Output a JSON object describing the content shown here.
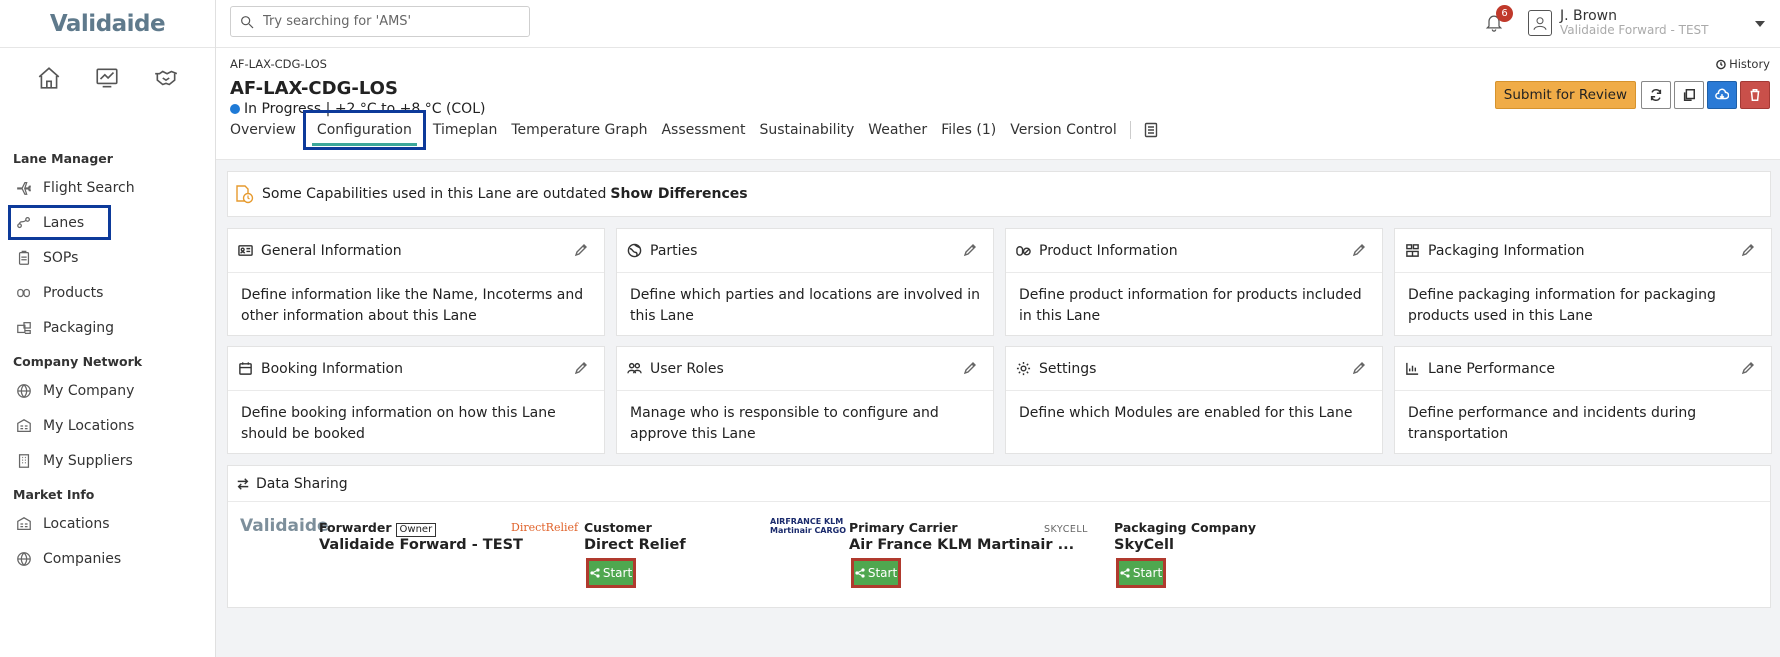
{
  "app": {
    "logo_text": "Validaide"
  },
  "search": {
    "placeholder": "Try searching for 'AMS'"
  },
  "notifications": {
    "count": "6"
  },
  "user": {
    "name": "J. Brown",
    "org": "Validaide Forward - TEST"
  },
  "sidebar": {
    "sections": [
      {
        "title": "Lane Manager",
        "items": [
          "Flight Search",
          "Lanes",
          "SOPs",
          "Products",
          "Packaging"
        ]
      },
      {
        "title": "Company Network",
        "items": [
          "My Company",
          "My Locations",
          "My Suppliers"
        ]
      },
      {
        "title": "Market Info",
        "items": [
          "Locations",
          "Companies"
        ]
      }
    ]
  },
  "header": {
    "breadcrumb": "AF-LAX-CDG-LOS",
    "history": "History",
    "title": "AF-LAX-CDG-LOS",
    "status": "In Progress | +2 °C to +8 °C (COL)",
    "submit_label": "Submit for Review",
    "tabs": [
      "Overview",
      "Configuration",
      "Timeplan",
      "Temperature Graph",
      "Assessment",
      "Sustainability",
      "Weather",
      "Files (1)",
      "Version Control"
    ]
  },
  "alert": {
    "text": "Some Capabilities used in this Lane are outdated",
    "link": "Show Differences"
  },
  "cards": [
    {
      "title": "General Information",
      "icon": "id-card-icon",
      "body": "Define information like the Name, Incoterms and other information about this Lane"
    },
    {
      "title": "Parties",
      "icon": "globe-icon",
      "body": "Define which parties and locations are involved in this Lane"
    },
    {
      "title": "Product Information",
      "icon": "pills-icon",
      "body": "Define product information for products included in this Lane"
    },
    {
      "title": "Packaging Information",
      "icon": "boxes-icon",
      "body": "Define packaging information for packaging products used in this Lane"
    },
    {
      "title": "Booking Information",
      "icon": "calendar-icon",
      "body": "Define booking information on how this Lane should be booked"
    },
    {
      "title": "User Roles",
      "icon": "users-icon",
      "body": "Manage who is responsible to configure and approve this Lane"
    },
    {
      "title": "Settings",
      "icon": "gear-icon",
      "body": "Define which Modules are enabled for this Lane"
    },
    {
      "title": "Lane Performance",
      "icon": "chart-icon",
      "body": "Define performance and incidents during transportation"
    }
  ],
  "data_sharing": {
    "title": "Data Sharing",
    "parties": [
      {
        "logo": "Validaide",
        "role": "Forwarder",
        "tag": "Owner",
        "name": "Validaide Forward - TEST",
        "start": ""
      },
      {
        "logo": "DirectRelief",
        "role": "Customer",
        "tag": "",
        "name": "Direct Relief",
        "start": "Start"
      },
      {
        "logo": "AIRFRANCE KLM Martinair CARGO",
        "role": "Primary Carrier",
        "tag": "",
        "name": "Air France KLM Martinair ...",
        "start": "Start"
      },
      {
        "logo": "SKYCELL",
        "role": "Packaging Company",
        "tag": "",
        "name": "SkyCell",
        "start": "Start"
      }
    ]
  },
  "colors": {
    "accent": "#3ca79a",
    "submit": "#f0ac47",
    "status_dot": "#1e7ad6",
    "start_btn": "#4fa74f",
    "highlight": "#0d3a9a"
  }
}
